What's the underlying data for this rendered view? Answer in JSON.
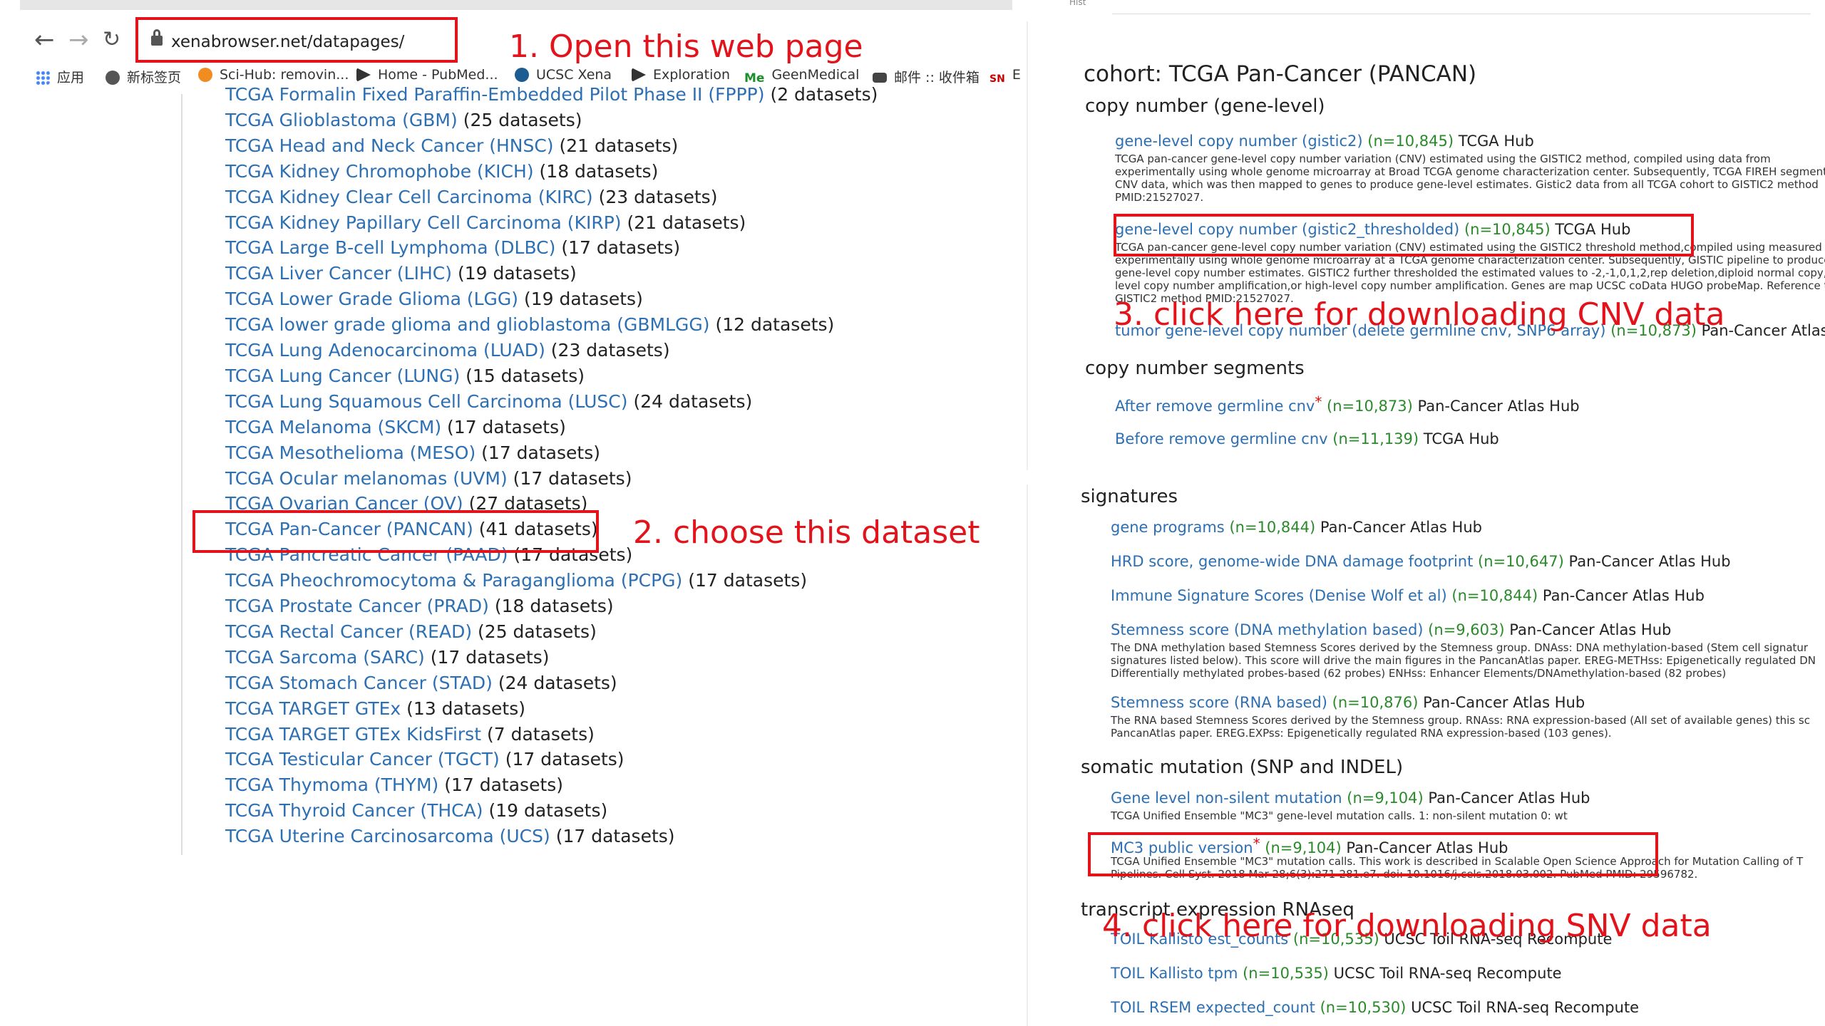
{
  "browser": {
    "url": "xenabrowser.net/datapages/",
    "bookmarks": [
      {
        "label": "应用",
        "icon": "apps-grid-icon"
      },
      {
        "label": "新标签页",
        "icon": "globe-icon"
      },
      {
        "label": "Sci-Hub: removin...",
        "icon": "scihub-icon"
      },
      {
        "label": "Home - PubMed...",
        "icon": "pubmed-icon"
      },
      {
        "label": "UCSC Xena",
        "icon": "xena-icon"
      },
      {
        "label": "Exploration",
        "icon": "exploration-icon"
      },
      {
        "label": "GeenMedical",
        "icon": "geenmedical-icon"
      },
      {
        "label": "邮件 :: 收件箱",
        "icon": "mail-icon"
      },
      {
        "label": "E",
        "icon": "sn-icon"
      }
    ],
    "bookmark_icon_text": {
      "geenmedical": "Me",
      "sn": "SN"
    }
  },
  "datasets": [
    {
      "name": "TCGA Formalin Fixed Paraffin-Embedded Pilot Phase II (FPPP)",
      "count": "(2 datasets)"
    },
    {
      "name": "TCGA Glioblastoma (GBM)",
      "count": "(25 datasets)"
    },
    {
      "name": "TCGA Head and Neck Cancer (HNSC)",
      "count": "(21 datasets)"
    },
    {
      "name": "TCGA Kidney Chromophobe (KICH)",
      "count": "(18 datasets)"
    },
    {
      "name": "TCGA Kidney Clear Cell Carcinoma (KIRC)",
      "count": "(23 datasets)"
    },
    {
      "name": "TCGA Kidney Papillary Cell Carcinoma (KIRP)",
      "count": "(21 datasets)"
    },
    {
      "name": "TCGA Large B-cell Lymphoma (DLBC)",
      "count": "(17 datasets)"
    },
    {
      "name": "TCGA Liver Cancer (LIHC)",
      "count": "(19 datasets)"
    },
    {
      "name": "TCGA Lower Grade Glioma (LGG)",
      "count": "(19 datasets)"
    },
    {
      "name": "TCGA lower grade glioma and glioblastoma (GBMLGG)",
      "count": "(12 datasets)"
    },
    {
      "name": "TCGA Lung Adenocarcinoma (LUAD)",
      "count": "(23 datasets)"
    },
    {
      "name": "TCGA Lung Cancer (LUNG)",
      "count": "(15 datasets)"
    },
    {
      "name": "TCGA Lung Squamous Cell Carcinoma (LUSC)",
      "count": "(24 datasets)"
    },
    {
      "name": "TCGA Melanoma (SKCM)",
      "count": "(17 datasets)"
    },
    {
      "name": "TCGA Mesothelioma (MESO)",
      "count": "(17 datasets)"
    },
    {
      "name": "TCGA Ocular melanomas (UVM)",
      "count": "(17 datasets)"
    },
    {
      "name": "TCGA Ovarian Cancer (OV)",
      "count": "(27 datasets)"
    },
    {
      "name": "TCGA Pan-Cancer (PANCAN)",
      "count": "(41 datasets)"
    },
    {
      "name": "TCGA Pancreatic Cancer (PAAD)",
      "count": "(17 datasets)"
    },
    {
      "name": "TCGA Pheochromocytoma & Paraganglioma (PCPG)",
      "count": "(17 datasets)"
    },
    {
      "name": "TCGA Prostate Cancer (PRAD)",
      "count": "(18 datasets)"
    },
    {
      "name": "TCGA Rectal Cancer (READ)",
      "count": "(25 datasets)"
    },
    {
      "name": "TCGA Sarcoma (SARC)",
      "count": "(17 datasets)"
    },
    {
      "name": "TCGA Stomach Cancer (STAD)",
      "count": "(24 datasets)"
    },
    {
      "name": "TCGA TARGET GTEx",
      "count": "(13 datasets)"
    },
    {
      "name": "TCGA TARGET GTEx KidsFirst",
      "count": "(7 datasets)"
    },
    {
      "name": "TCGA Testicular Cancer (TGCT)",
      "count": "(17 datasets)"
    },
    {
      "name": "TCGA Thymoma (THYM)",
      "count": "(17 datasets)"
    },
    {
      "name": "TCGA Thyroid Cancer (THCA)",
      "count": "(19 datasets)"
    },
    {
      "name": "TCGA Uterine Carcinosarcoma (UCS)",
      "count": "(17 datasets)"
    }
  ],
  "cohort": {
    "top_fragment": "Hist",
    "title": "cohort: TCGA Pan-Cancer (PANCAN)",
    "sections": [
      {
        "heading": "copy number (gene-level)",
        "entries": [
          {
            "label": "gene-level copy number (gistic2)",
            "n": "(n=10,845)",
            "hub": "TCGA Hub",
            "desc": "TCGA pan-cancer gene-level copy number variation (CNV) estimated using the GISTIC2 method, compiled using data from experimentally using whole genome microarray at Broad TCGA genome characterization center. Subsequently, TCGA FIREH segmented CNV data, which was then mapped to genes to produce gene-level estimates. Gistic2 data from all TCGA cohort to GISTIC2 method PMID:21527027."
          },
          {
            "label": "gene-level copy number (gistic2_thresholded)",
            "n": "(n=10,845)",
            "hub": "TCGA Hub",
            "desc": "TCGA pan-cancer gene-level copy number variation (CNV) estimated using the GISTIC2 threshold method,compiled using measured experimentally using whole genome microarray at a TCGA genome characterization center. Subsequently, GISTIC pipeline to produce gene-level copy number estimates. GISTIC2 further thresholded the estimated values to -2,-1,0,1,2,rep deletion,diploid normal copy,low-level copy number amplification,or high-level copy number amplification. Genes are map UCSC coData HUGO probeMap. Reference to GISTIC2 method PMID:21527027."
          },
          {
            "label": "tumor gene-level copy number (delete germline cnv, SNP6 array)",
            "n": "(n=10,873)",
            "hub": "Pan-Cancer Atlas Hub",
            "desc": ""
          }
        ]
      },
      {
        "heading": "copy number segments",
        "entries": [
          {
            "label": "After remove germline cnv",
            "star": "*",
            "n": "(n=10,873)",
            "hub": "Pan-Cancer Atlas Hub",
            "desc": ""
          },
          {
            "label": "Before remove germline cnv",
            "n": "(n=11,139)",
            "hub": "TCGA Hub",
            "desc": ""
          }
        ]
      },
      {
        "heading": "signatures",
        "entries": [
          {
            "label": "gene programs",
            "n": "(n=10,844)",
            "hub": "Pan-Cancer Atlas Hub",
            "desc": ""
          },
          {
            "label": "HRD score, genome-wide DNA damage footprint",
            "n": "(n=10,647)",
            "hub": "Pan-Cancer Atlas Hub",
            "desc": ""
          },
          {
            "label": "Immune Signature Scores (Denise Wolf et al)",
            "n": "(n=10,844)",
            "hub": "Pan-Cancer Atlas Hub",
            "desc": ""
          },
          {
            "label": "Stemness score (DNA methylation based)",
            "n": "(n=9,603)",
            "hub": "Pan-Cancer Atlas Hub",
            "desc": "The DNA methylation based Stemness Scores derived by the Stemness group. DNAss: DNA methylation-based (Stem cell signatur signatures listed below). This score will drive the main figures in the PancanAtlas paper. EREG-METHss: Epigenetically regulated DN Differentially methylated probes-based (62 probes) ENHss: Enhancer Elements/DNAmethylation-based (82 probes)"
          },
          {
            "label": "Stemness score (RNA based)",
            "n": "(n=10,876)",
            "hub": "Pan-Cancer Atlas Hub",
            "desc": "The RNA based Stemness Scores derived by the Stemness group. RNAss: RNA expression-based (All set of available genes) this sc PancanAtlas paper. EREG.EXPss: Epigenetically regulated RNA expression-based (103 genes)."
          }
        ]
      },
      {
        "heading": "somatic mutation (SNP and INDEL)",
        "entries": [
          {
            "label": "Gene level non-silent mutation",
            "n": "(n=9,104)",
            "hub": "Pan-Cancer Atlas Hub",
            "desc": "TCGA Unified Ensemble \"MC3\" gene-level mutation calls. 1: non-silent mutation 0: wt"
          },
          {
            "label": "MC3 public version",
            "star": "*",
            "n": "(n=9,104)",
            "hub": "Pan-Cancer Atlas Hub",
            "desc": "TCGA Unified Ensemble \"MC3\" mutation calls. This work is described in Scalable Open Science Approach for Mutation Calling of T Pipelines. Cell Syst. 2018 Mar 28;6(3):271-281.e7. doi: 10.1016/j.cels.2018.03.002. PubMed PMID: 29596782."
          }
        ]
      },
      {
        "heading": "transcript expression RNAseq",
        "entries": [
          {
            "label": "TOIL Kallisto est_counts",
            "n": "(n=10,535)",
            "hub": "UCSC Toil RNA-seq Recompute",
            "desc": ""
          },
          {
            "label": "TOIL Kallisto tpm",
            "n": "(n=10,535)",
            "hub": "UCSC Toil RNA-seq Recompute",
            "desc": ""
          },
          {
            "label": "TOIL RSEM expected_count",
            "n": "(n=10,530)",
            "hub": "UCSC Toil RNA-seq Recompute",
            "desc": ""
          }
        ]
      }
    ]
  },
  "annotations": {
    "step1": "1. Open this web page",
    "step2": "2. choose this dataset",
    "step3": "3. click here for downloading CNV data",
    "step4": "4. click here for downloading SNV data",
    "color": "#e3131b"
  },
  "colors": {
    "link": "#2c6fb3",
    "count": "#2a8a2a",
    "annotation": "#e3131b"
  }
}
